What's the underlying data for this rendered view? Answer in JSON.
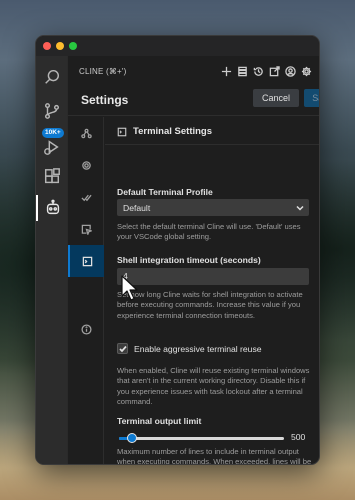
{
  "panel": {
    "title": "CLINE (⌘+')"
  },
  "activity_bar": {
    "badge": "10K+"
  },
  "settings": {
    "title": "Settings",
    "cancel_label": "Cancel",
    "save_label": "Save"
  },
  "tabs": [
    {
      "name": "api-config",
      "icon": "nodes-icon"
    },
    {
      "name": "general",
      "icon": "gear-icon"
    },
    {
      "name": "features",
      "icon": "checks-icon"
    },
    {
      "name": "browser",
      "icon": "cursor-square-icon"
    },
    {
      "name": "terminal",
      "icon": "terminal-icon",
      "active": true
    },
    {
      "name": "about",
      "icon": "info-icon"
    }
  ],
  "terminal": {
    "section_title": "Terminal Settings",
    "profile_label": "Default Terminal Profile",
    "profile_value": "Default",
    "profile_desc": "Select the default terminal Cline will use. 'Default' uses your VSCode global setting.",
    "timeout_label": "Shell integration timeout (seconds)",
    "timeout_value": "4",
    "timeout_desc": "Set how long Cline waits for shell integration to activate before executing commands. Increase this value if you experience terminal connection timeouts.",
    "reuse_label": "Enable aggressive terminal reuse",
    "reuse_checked": true,
    "reuse_desc": "When enabled, Cline will reuse existing terminal windows that aren't in the current working directory. Disable this if you experience issues with task lockout after a terminal command.",
    "output_label": "Terminal output limit",
    "output_value": "500",
    "output_fraction": 0.08,
    "output_desc": "Maximum number of lines to include in terminal output when executing commands. When exceeded, lines will be removed from the middle, saving tokens."
  }
}
